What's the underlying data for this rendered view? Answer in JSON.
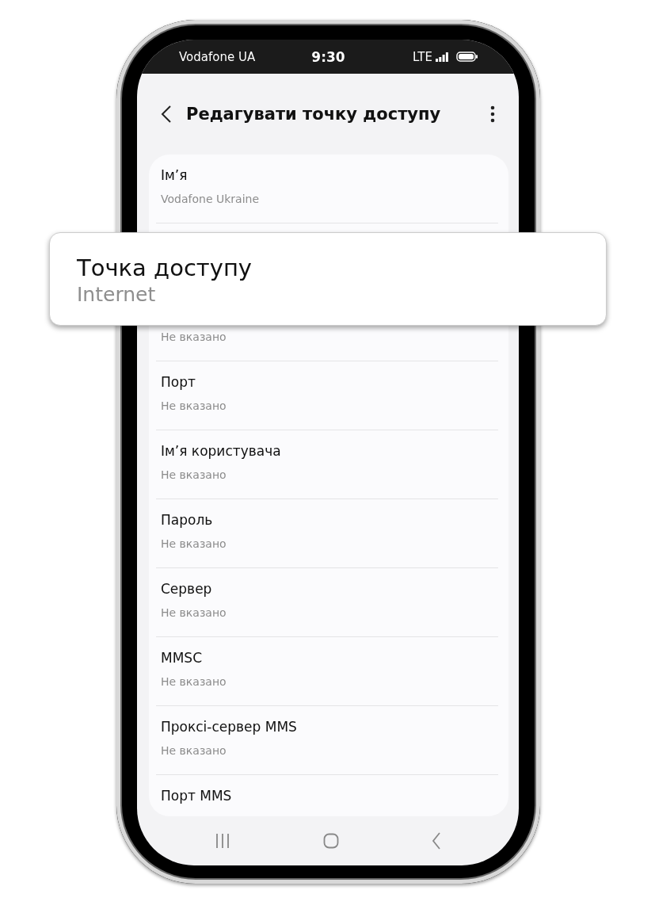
{
  "status_bar": {
    "carrier": "Vodafone UA",
    "time": "9:30",
    "network": "LTE"
  },
  "header": {
    "title": "Редагувати точку доступу"
  },
  "settings": [
    {
      "title": "Ім’я",
      "value": "Vodafone Ukraine"
    },
    {
      "value": "Не вказано"
    },
    {
      "title": "Порт",
      "value": "Не вказано"
    },
    {
      "title": "Ім’я користувача",
      "value": "Не вказано"
    },
    {
      "title": "Пароль",
      "value": "Не вказано"
    },
    {
      "title": "Сервер",
      "value": "Не вказано"
    },
    {
      "title": "MMSC",
      "value": "Не вказано"
    },
    {
      "title": "Проксі-сервер MMS",
      "value": "Не вказано"
    },
    {
      "title": "Порт MMS"
    }
  ],
  "callout": {
    "title": "Точка доступу",
    "value": "Internet"
  }
}
